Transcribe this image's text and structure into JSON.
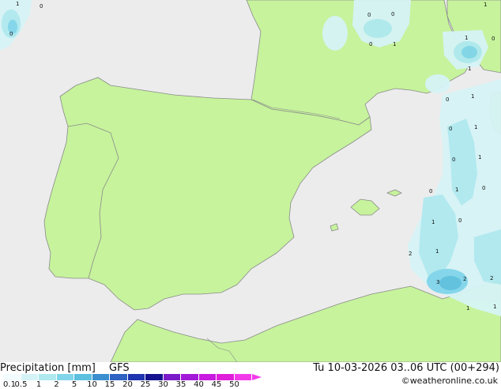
{
  "map": {
    "land_color": "#c6f39c",
    "sea_color": "#ececec",
    "border_color": "#8a8a8a",
    "precip_colors": [
      "#d6f4f6",
      "#aee9f0",
      "#80d5ea",
      "#5cc0de"
    ],
    "values": [
      "1",
      "0",
      "0",
      "0",
      "0",
      "1",
      "1",
      "0",
      "1",
      "0",
      "1",
      "0",
      "1",
      "1",
      "0",
      "1",
      "0",
      "0",
      "1",
      "0",
      "1",
      "0",
      "2",
      "3",
      "2",
      "2",
      "1",
      "1",
      "1"
    ]
  },
  "footer": {
    "title": "Precipitation [mm]",
    "model": "GFS",
    "valid": "Tu 10-03-2026 03..06 UTC (00+294)",
    "credit": "©weatheronline.co.uk"
  },
  "legend": {
    "labels": [
      "0.1",
      "0.5",
      "1",
      "2",
      "5",
      "10",
      "15",
      "20",
      "25",
      "30",
      "35",
      "40",
      "45",
      "50"
    ],
    "colors": [
      "#f2fbfd",
      "#d4f3f7",
      "#aee9f0",
      "#80d5ea",
      "#5cc0de",
      "#3a8fcf",
      "#2f62c2",
      "#1f34b0",
      "#14128e",
      "#7a1bc9",
      "#a31ad8",
      "#c81ae0",
      "#e01fda",
      "#f23aeb"
    ]
  }
}
